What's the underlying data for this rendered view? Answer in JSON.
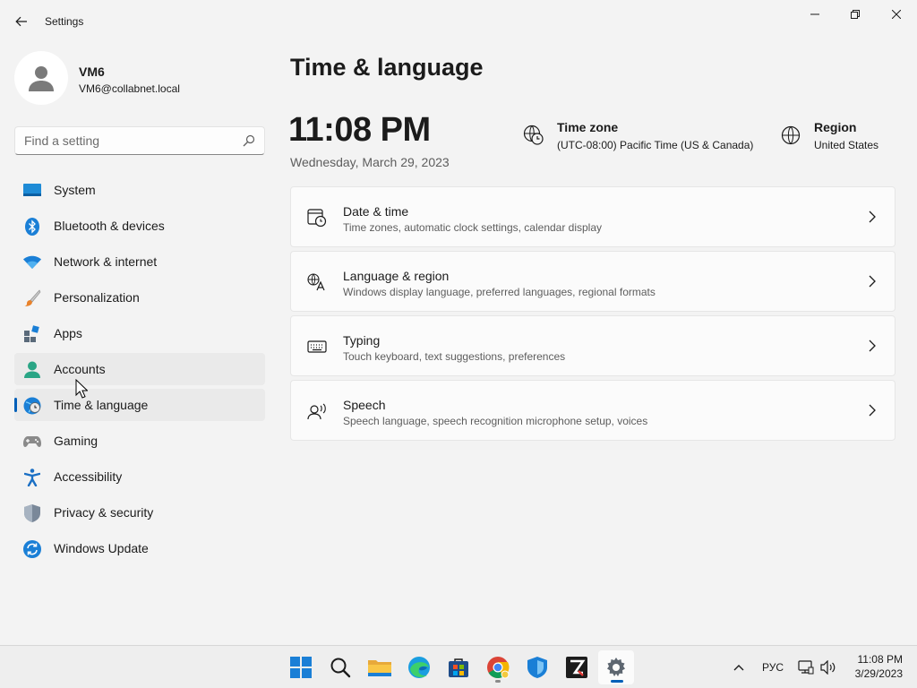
{
  "window": {
    "title": "Settings"
  },
  "profile": {
    "name": "VM6",
    "email": "VM6@collabnet.local"
  },
  "search": {
    "placeholder": "Find a setting"
  },
  "sidebar": {
    "items": [
      {
        "label": "System",
        "icon": "system-icon"
      },
      {
        "label": "Bluetooth & devices",
        "icon": "bluetooth-icon"
      },
      {
        "label": "Network & internet",
        "icon": "wifi-icon"
      },
      {
        "label": "Personalization",
        "icon": "brush-icon"
      },
      {
        "label": "Apps",
        "icon": "apps-icon"
      },
      {
        "label": "Accounts",
        "icon": "account-icon",
        "state": "hover"
      },
      {
        "label": "Time & language",
        "icon": "time-language-icon",
        "state": "selected"
      },
      {
        "label": "Gaming",
        "icon": "gamepad-icon"
      },
      {
        "label": "Accessibility",
        "icon": "accessibility-icon"
      },
      {
        "label": "Privacy & security",
        "icon": "shield-icon"
      },
      {
        "label": "Windows Update",
        "icon": "update-icon"
      }
    ]
  },
  "main": {
    "title": "Time & language",
    "time": "11:08 PM",
    "date": "Wednesday, March 29, 2023",
    "timezone": {
      "label": "Time zone",
      "value": "(UTC-08:00) Pacific Time (US & Canada)"
    },
    "region": {
      "label": "Region",
      "value": "United States"
    },
    "cards": [
      {
        "title": "Date & time",
        "subtitle": "Time zones, automatic clock settings, calendar display",
        "icon": "calendar-clock-icon"
      },
      {
        "title": "Language & region",
        "subtitle": "Windows display language, preferred languages, regional formats",
        "icon": "language-icon"
      },
      {
        "title": "Typing",
        "subtitle": "Touch keyboard, text suggestions, preferences",
        "icon": "keyboard-icon"
      },
      {
        "title": "Speech",
        "subtitle": "Speech language, speech recognition microphone setup, voices",
        "icon": "speech-icon"
      }
    ]
  },
  "taskbar": {
    "apps": [
      "start-icon",
      "search-icon",
      "file-explorer-icon",
      "edge-icon",
      "store-icon",
      "chrome-icon",
      "defender-icon",
      "filezilla-icon",
      "settings-icon"
    ],
    "language": "РУС",
    "clock_time": "11:08 PM",
    "clock_date": "3/29/2023"
  },
  "colors": {
    "accent": "#005fb8",
    "background": "#f3f3f3",
    "card": "#fbfbfb"
  }
}
